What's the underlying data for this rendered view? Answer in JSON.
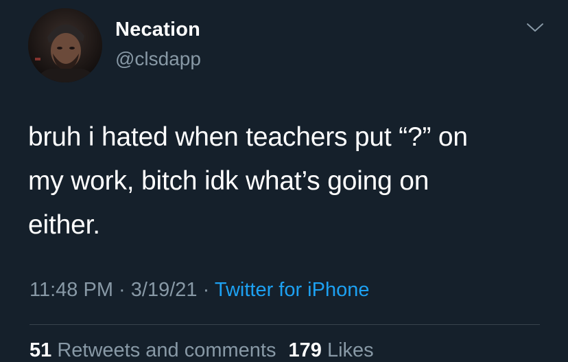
{
  "user": {
    "display_name": "Necation",
    "handle": "@clsdapp",
    "avatar_icon": "profile-photo"
  },
  "menu": {
    "icon": "chevron-down-icon"
  },
  "tweet": {
    "lines": [
      "bruh i hated when teachers put “?” on",
      "my work, bitch idk what’s going on",
      "either."
    ]
  },
  "meta": {
    "time": "11:48 PM",
    "separator": "·",
    "date": "3/19/21",
    "source": "Twitter for iPhone"
  },
  "stats": {
    "retweets_count": "51",
    "retweets_label": "Retweets and comments",
    "likes_count": "179",
    "likes_label": "Likes"
  },
  "colors": {
    "background": "#15202b",
    "text_primary": "#ffffff",
    "text_secondary": "#8899a6",
    "link": "#1da1f2",
    "divider": "#38444d"
  }
}
